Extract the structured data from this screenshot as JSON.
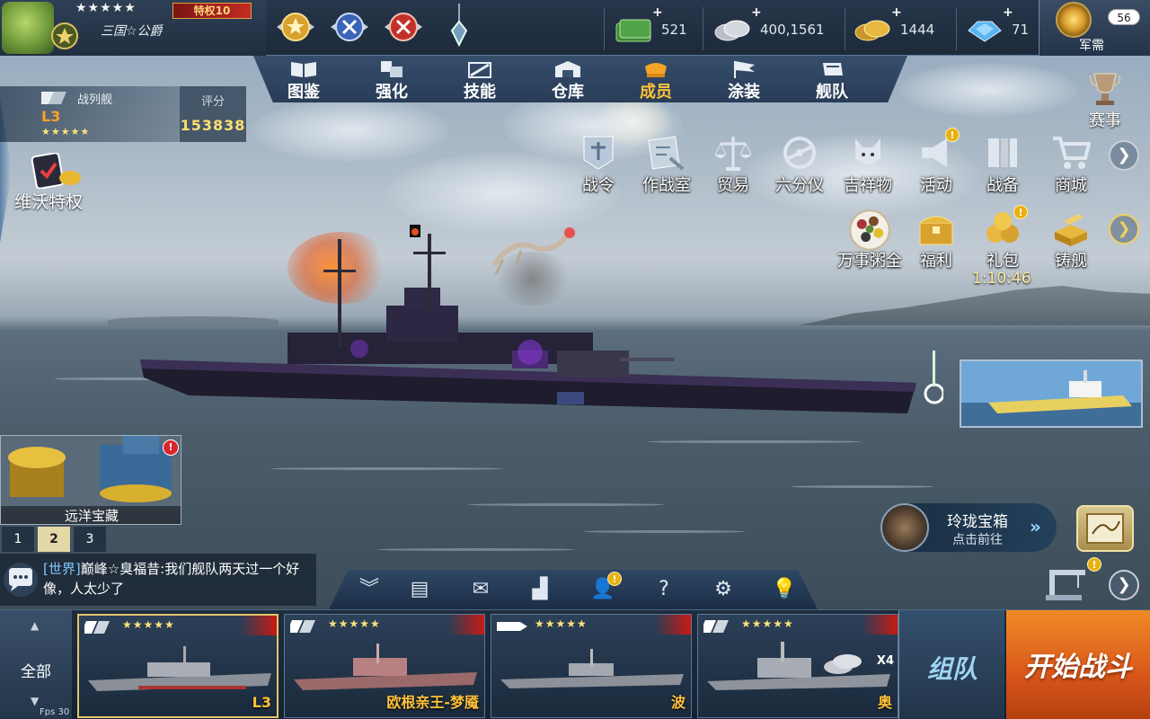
{
  "player": {
    "stars": "★★★★★",
    "vip": "特权10",
    "name": "三国☆公爵"
  },
  "currencies": [
    {
      "icon": "cash-icon",
      "value": "521"
    },
    {
      "icon": "silver-coin-icon",
      "value": "400,1561"
    },
    {
      "icon": "gold-coin-icon",
      "value": "1444"
    },
    {
      "icon": "diamond-icon",
      "value": "71"
    }
  ],
  "supply": {
    "label": "军需",
    "badge": "56"
  },
  "nav_tabs": [
    {
      "label": "图鉴",
      "icon": "book-icon"
    },
    {
      "label": "强化",
      "icon": "upgrade-icon"
    },
    {
      "label": "技能",
      "icon": "skill-icon"
    },
    {
      "label": "仓库",
      "icon": "warehouse-icon"
    },
    {
      "label": "成员",
      "icon": "crew-icon",
      "active": true
    },
    {
      "label": "涂装",
      "icon": "flag-icon"
    },
    {
      "label": "舰队",
      "icon": "fleet-icon"
    }
  ],
  "ship": {
    "type": "战列舰",
    "name": "L3",
    "stars": "★★★★★",
    "rating_label": "评分",
    "rating": "153838"
  },
  "vip_privilege": "维沃特权",
  "event": "赛事",
  "features_row1": [
    {
      "label": "战令",
      "icon": "battle-pass-icon"
    },
    {
      "label": "作战室",
      "icon": "war-room-icon"
    },
    {
      "label": "贸易",
      "icon": "scales-icon"
    },
    {
      "label": "六分仪",
      "icon": "sextant-icon"
    },
    {
      "label": "吉祥物",
      "icon": "mascot-icon"
    },
    {
      "label": "活动",
      "icon": "megaphone-icon"
    },
    {
      "label": "战备",
      "icon": "readiness-icon"
    },
    {
      "label": "商城",
      "icon": "cart-icon"
    }
  ],
  "features_row2": [
    {
      "label": "万事粥全",
      "icon": "porridge-icon"
    },
    {
      "label": "福利",
      "icon": "welfare-chest-icon"
    },
    {
      "label": "礼包",
      "icon": "gift-pack-icon"
    },
    {
      "label": "铸舰",
      "icon": "forge-icon"
    }
  ],
  "gift_timer": "1:10:46",
  "treasure": {
    "label": "远洋宝藏"
  },
  "pages": [
    "1",
    "2",
    "3"
  ],
  "chat": {
    "channel": "[世界]",
    "message": "巅峰☆臭福昔:我们舰队两天过一个好像，人太少了"
  },
  "bottom_tools": [
    {
      "icon": "collapse-icon",
      "glyph": "︾"
    },
    {
      "icon": "clipboard-icon",
      "glyph": "▤"
    },
    {
      "icon": "mail-icon",
      "glyph": "✉"
    },
    {
      "icon": "ranking-icon",
      "glyph": "▟"
    },
    {
      "icon": "friends-icon",
      "glyph": "👤"
    },
    {
      "icon": "help-icon",
      "glyph": "?"
    },
    {
      "icon": "settings-icon",
      "glyph": "⚙"
    },
    {
      "icon": "hint-icon",
      "glyph": "💡"
    }
  ],
  "chest": {
    "title": "玲珑宝箱",
    "subtitle": "点击前往"
  },
  "roster": {
    "filter": "全部",
    "fps": "Fps 30",
    "ships": [
      {
        "name": "L3",
        "stars": "★★★★★"
      },
      {
        "name": "欧根亲王-梦魇",
        "stars": "★★★★★"
      },
      {
        "name": "波",
        "stars": "★★★★★"
      },
      {
        "name": "奥",
        "stars": "★★★★★",
        "extra": "X4"
      }
    ],
    "team": "组队",
    "battle": "开始战斗"
  }
}
